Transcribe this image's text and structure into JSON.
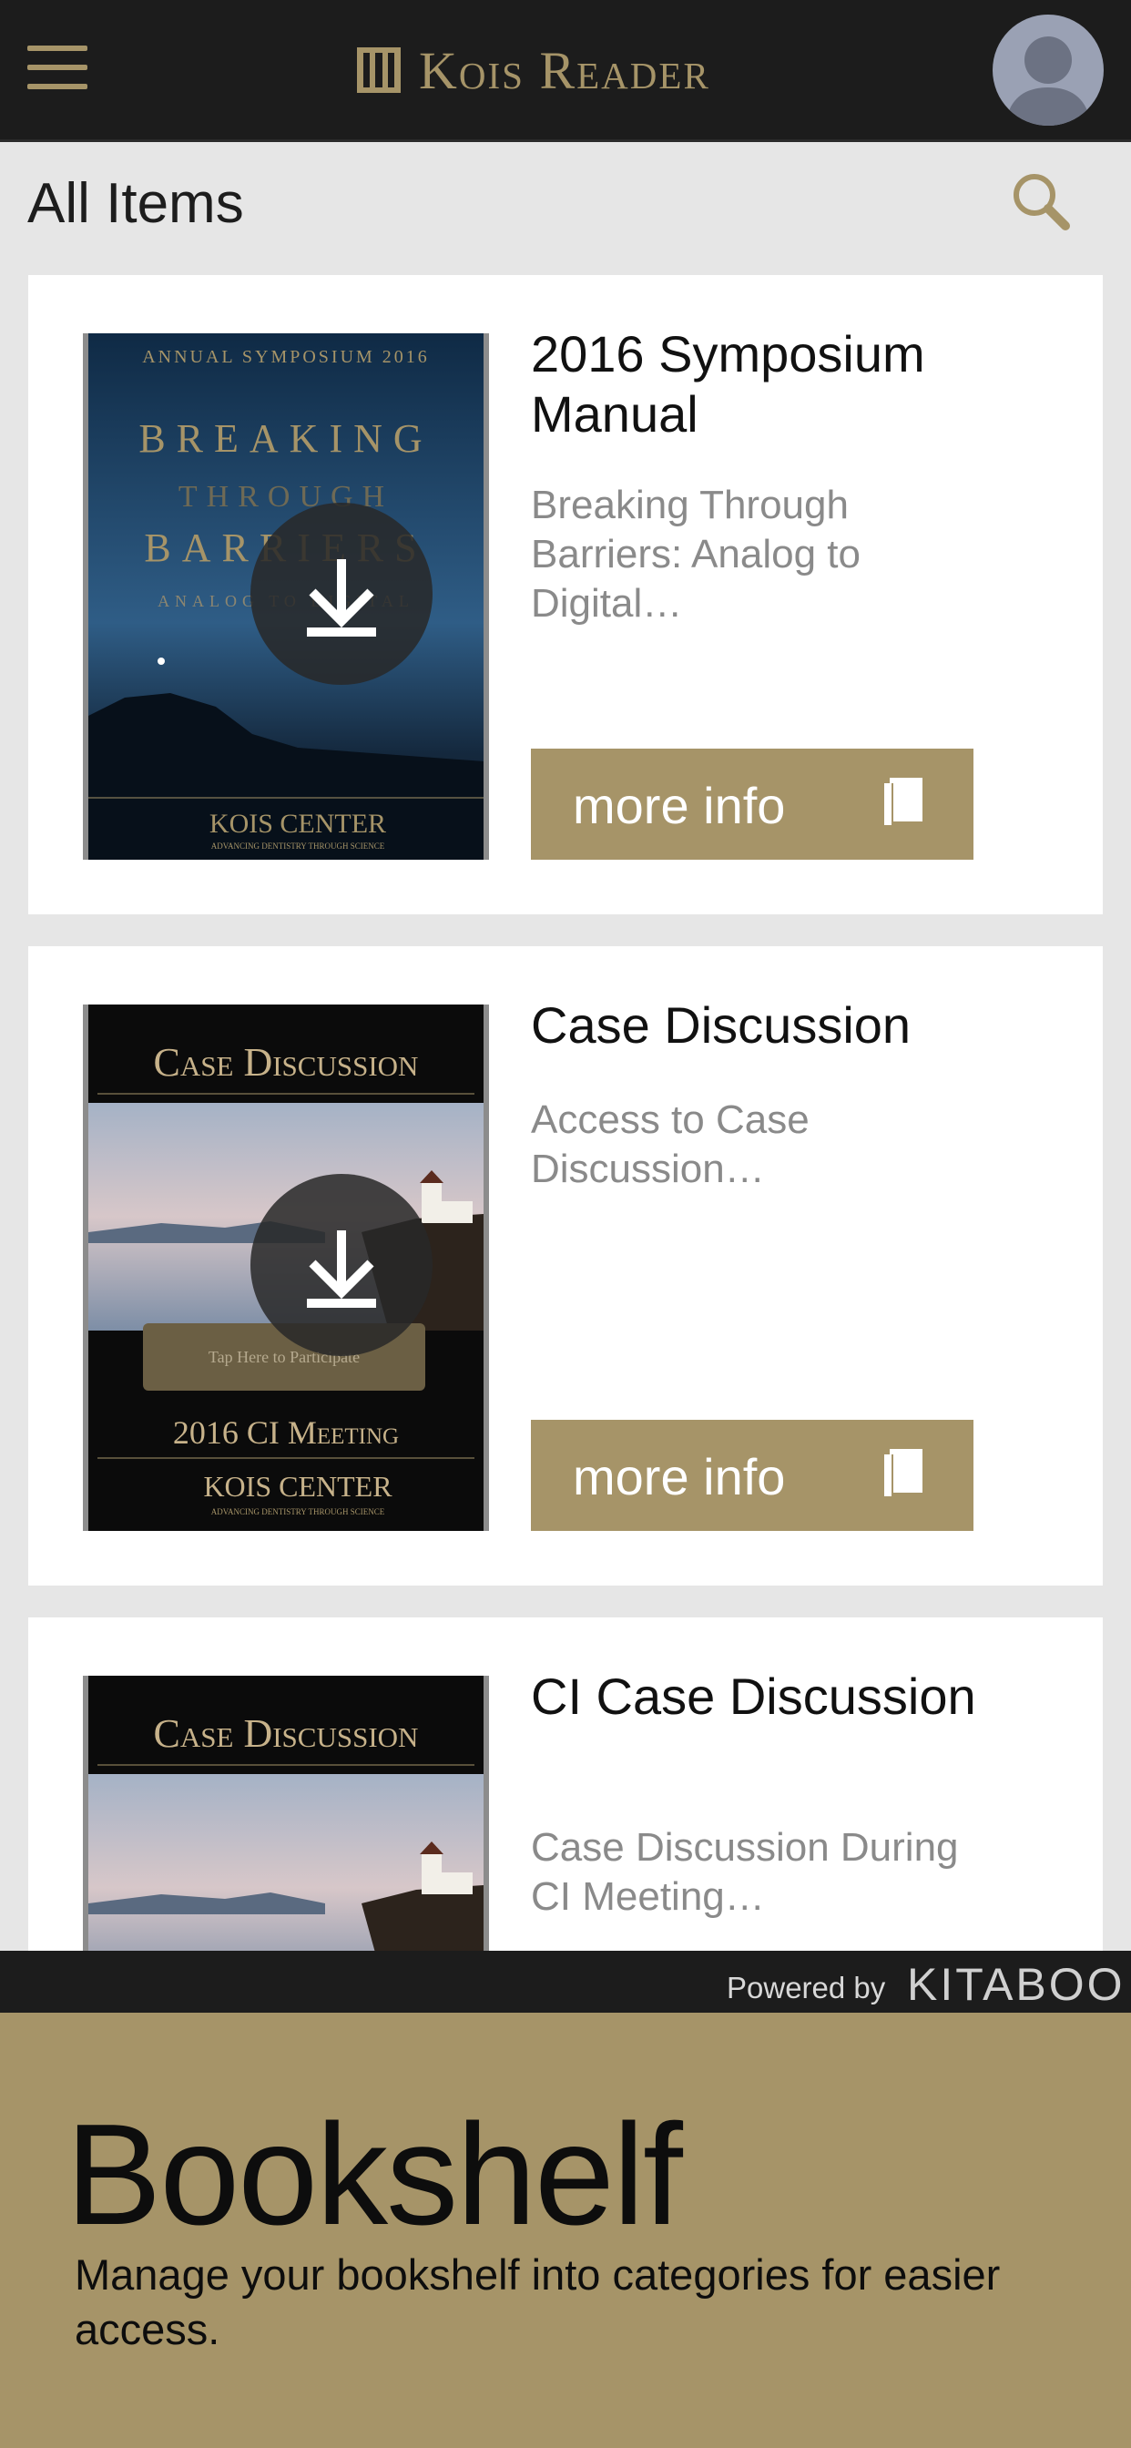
{
  "header": {
    "brand": "Kois Reader",
    "menu_icon": "hamburger-menu-icon",
    "avatar_icon": "user-avatar-icon"
  },
  "section": {
    "title": "All Items",
    "search_icon": "search-icon"
  },
  "items": [
    {
      "title": "2016 Symposium Manual",
      "description": "Breaking Through Barriers: Analog to Digital…",
      "button_label": "more info",
      "cover": {
        "top_text": "ANNUAL SYMPOSIUM 2016",
        "line1": "BREAKING",
        "line2": "THROUGH",
        "line3": "BARRIERS",
        "line4": "ANALOG TO DIGITAL",
        "footer": "KOIS CENTER",
        "footer_sub": "ADVANCING DENTISTRY THROUGH SCIENCE"
      }
    },
    {
      "title": "Case Discussion",
      "description": "Access to Case Discussion…",
      "button_label": "more info",
      "cover": {
        "top_text": "Case Discussion",
        "tap_label": "Tap Here to Participate",
        "meeting": "2016 CI Meeting",
        "footer": "KOIS CENTER",
        "footer_sub": "ADVANCING DENTISTRY THROUGH SCIENCE"
      }
    },
    {
      "title": "CI Case Discussion",
      "description": "Case Discussion During CI Meeting…",
      "cover": {
        "top_text": "Case Discussion"
      }
    }
  ],
  "footer": {
    "powered_by": "Powered by",
    "kitaboo": "KITABOO"
  },
  "panel": {
    "title": "Bookshelf",
    "description": "Manage your bookshelf into categories for easier access."
  },
  "colors": {
    "accent": "#a69468",
    "topbar": "#1c1c1c",
    "background": "#e6e6e6"
  }
}
